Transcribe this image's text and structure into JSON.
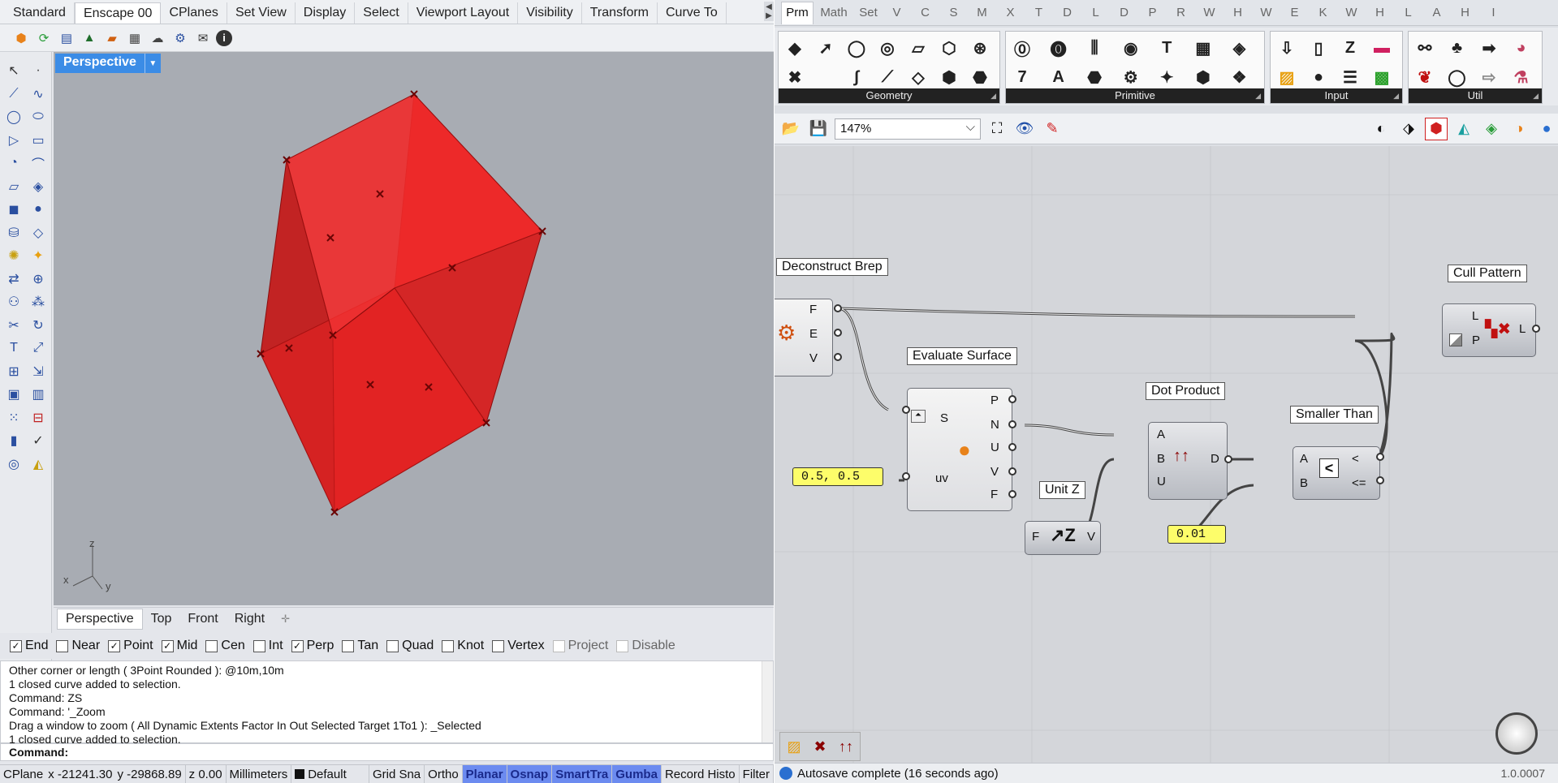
{
  "rhino": {
    "tabs": [
      "Standard",
      "Enscape 00",
      "CPlanes",
      "Set View",
      "Display",
      "Select",
      "Viewport Layout",
      "Visibility",
      "Transform",
      "Curve To"
    ],
    "toolbar_icons": [
      "enscape-start-icon",
      "refresh-icon",
      "monitor-icon",
      "tree-icon",
      "render-icon",
      "grid-icon",
      "upload-icon",
      "settings-icon",
      "mail-icon",
      "info-icon"
    ],
    "viewport_name": "Perspective",
    "axis": {
      "z": "z",
      "x": "x",
      "y": "y"
    },
    "viewport_tabs": [
      "Perspective",
      "Top",
      "Front",
      "Right"
    ],
    "osnaps": [
      {
        "label": "End",
        "checked": true
      },
      {
        "label": "Near",
        "checked": false
      },
      {
        "label": "Point",
        "checked": true
      },
      {
        "label": "Mid",
        "checked": true
      },
      {
        "label": "Cen",
        "checked": false
      },
      {
        "label": "Int",
        "checked": false
      },
      {
        "label": "Perp",
        "checked": true
      },
      {
        "label": "Tan",
        "checked": false
      },
      {
        "label": "Quad",
        "checked": false
      },
      {
        "label": "Knot",
        "checked": false
      },
      {
        "label": "Vertex",
        "checked": false
      },
      {
        "label": "Project",
        "checked": false,
        "disabled": true
      },
      {
        "label": "Disable",
        "checked": false,
        "disabled": true
      }
    ],
    "command_history": [
      "Other corner or length ( 3Point  Rounded ): @10m,10m",
      "1 closed curve added to selection.",
      "Command: ZS",
      "Command: '_Zoom",
      "Drag a window to zoom ( All  Dynamic  Extents  Factor  In  Out  Selected  Target  1To1 ): _Selected",
      "1 closed curve added to selection."
    ],
    "command_prompt": "Command:",
    "status": {
      "cplane": "CPlane",
      "x": "x -21241.30",
      "y": "y -29868.89",
      "z": "z 0.00",
      "units": "Millimeters",
      "layer": "Default",
      "items": [
        "Grid Sna",
        "Ortho",
        "Planar",
        "Osnap",
        "SmartTra",
        "Gumba",
        "Record Histo",
        "Filter"
      ],
      "highlighted": [
        "Planar",
        "Osnap",
        "SmartTra",
        "Gumba"
      ]
    },
    "cube_color": "#e8191a"
  },
  "grasshopper": {
    "tabs": [
      "Prm",
      "Math",
      "Set",
      "V",
      "C",
      "S",
      "M",
      "X",
      "T",
      "D",
      "L",
      "D",
      "P",
      "R",
      "W",
      "H",
      "W",
      "E",
      "K",
      "W",
      "H",
      "L",
      "A",
      "H",
      "I"
    ],
    "panels": [
      "Geometry",
      "Primitive",
      "Input",
      "Util"
    ],
    "zoom": "147%",
    "components": {
      "deconstruct_brep": {
        "label": "Deconstruct Brep",
        "outputs": [
          "F",
          "E",
          "V"
        ]
      },
      "evaluate_surface": {
        "label": "Evaluate Surface",
        "inputs": [
          "S",
          "uv"
        ],
        "outputs": [
          "P",
          "N",
          "U",
          "V",
          "F"
        ]
      },
      "uv_panel": {
        "value": "0.5, 0.5"
      },
      "unit_z": {
        "label": "Unit Z",
        "input": "F",
        "output": "V"
      },
      "dot_product": {
        "label": "Dot Product",
        "inputs": [
          "A",
          "B",
          "U"
        ],
        "output": "D"
      },
      "tolerance_panel": {
        "value": "0.01"
      },
      "smaller_than": {
        "label": "Smaller Than",
        "inputs": [
          "A",
          "B"
        ],
        "outputs": [
          "<",
          "<="
        ]
      },
      "cull_pattern": {
        "label": "Cull Pattern",
        "inputs": [
          "L",
          "P"
        ],
        "output": "L"
      }
    },
    "status": "Autosave complete (16 seconds ago)",
    "version": "1.0.0007"
  }
}
